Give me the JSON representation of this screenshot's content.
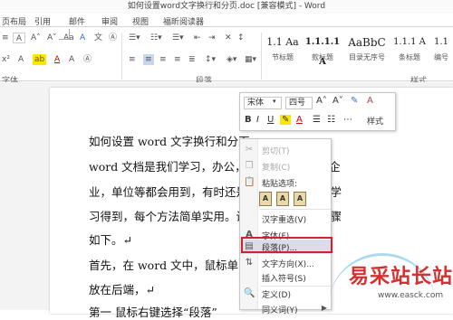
{
  "window": {
    "title": "如何设置word文字换行和分页.doc [兼容模式] - Word"
  },
  "tabs": [
    "页布局",
    "引用",
    "邮件",
    "审阅",
    "视图",
    "福昕阅读器"
  ],
  "ribbon": {
    "font_size_box": "A",
    "groups": {
      "font": "字体",
      "paragraph": "段落",
      "styles": "样式"
    },
    "styles": [
      {
        "sample": "1.1 Aa",
        "name": "节标题"
      },
      {
        "sample": "1.1.1.1 A",
        "name": "款标题"
      },
      {
        "sample": "AaBbC",
        "name": "目录无序号"
      },
      {
        "sample": "1.1.1 A",
        "name": "条标题"
      },
      {
        "sample": "1.1",
        "name": "编号"
      }
    ]
  },
  "document": {
    "lines": [
      "如何设置 word 文字换行和分页",
      "word 文档是我们学习，办公，                    辑软件，学校，企",
      "业，单位等都会用到，有时还是                    哦，可以在这里学",
      "习得到，每个方法简单实用。设                    分页很简单，步骤",
      "如下。↵",
      "首先，在 word 文中，鼠标单击                    放",
      "放在后端，↵",
      "第一  鼠标右键选择“段落”"
    ]
  },
  "mini_toolbar": {
    "font_name": "宋体",
    "font_size": "四号",
    "bold": "B",
    "italic": "I",
    "underline": "U",
    "styles_label": "样式"
  },
  "context_menu": {
    "items": [
      {
        "label": "剪切(T)",
        "icon": "scissors-icon",
        "enabled": false
      },
      {
        "label": "复制(C)",
        "icon": "copy-icon",
        "enabled": false
      },
      {
        "label": "粘贴选项:",
        "icon": "paste-icon",
        "enabled": true
      },
      {
        "label": "汉字重选(V)",
        "icon": "",
        "enabled": true
      },
      {
        "label": "字体(F)...",
        "icon": "font-icon",
        "enabled": true
      },
      {
        "label": "段落(P)...",
        "icon": "paragraph-icon",
        "enabled": true,
        "highlighted": true
      },
      {
        "label": "文字方向(X)...",
        "icon": "text-direction-icon",
        "enabled": true
      },
      {
        "label": "插入符号(S)",
        "icon": "",
        "enabled": true
      },
      {
        "label": "定义(D)",
        "icon": "define-icon",
        "enabled": true
      },
      {
        "label": "同义词(Y)",
        "icon": "",
        "enabled": true,
        "submenu": true
      }
    ],
    "paste_options": [
      "A",
      "A",
      "A"
    ]
  },
  "watermark": {
    "text": "易采站长站",
    "url": "www.easck.com"
  },
  "colors": {
    "highlight_border": "#d3212c",
    "menu_hover": "#dadce8",
    "watermark": "#d62f2f"
  }
}
